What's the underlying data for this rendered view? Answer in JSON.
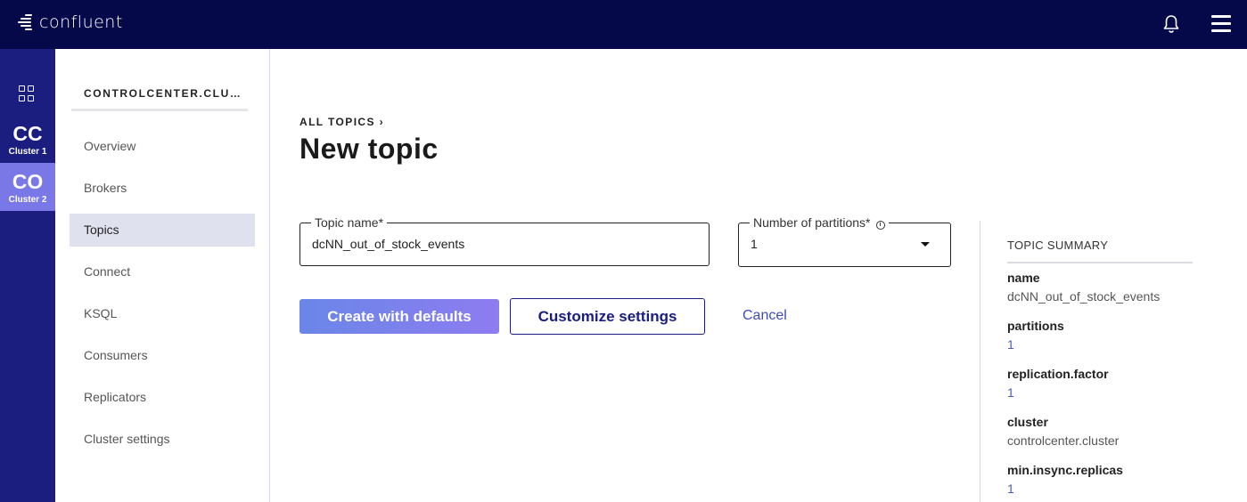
{
  "app": {
    "logo_text": "confluent"
  },
  "topbar": {
    "icons": [
      "bell-icon",
      "hamburger-menu-icon"
    ]
  },
  "clusters": [
    {
      "abbr": "CC",
      "name": "Cluster 1",
      "selected": false
    },
    {
      "abbr": "CO",
      "name": "Cluster 2",
      "selected": true
    }
  ],
  "sidebar": {
    "cluster_title": "CONTROLCENTER.CLUSTER",
    "items": [
      {
        "label": "Overview"
      },
      {
        "label": "Brokers"
      },
      {
        "label": "Topics",
        "active": true
      },
      {
        "label": "Connect"
      },
      {
        "label": "KSQL"
      },
      {
        "label": "Consumers"
      },
      {
        "label": "Replicators"
      },
      {
        "label": "Cluster settings"
      }
    ]
  },
  "main": {
    "breadcrumb": "ALL TOPICS ›",
    "title": "New topic",
    "topic_name_label": "Topic name*",
    "topic_name_value": "dcNN_out_of_stock_events",
    "partitions_label": "Number of partitions*",
    "partitions_value": "1",
    "create_button": "Create with defaults",
    "customize_button": "Customize settings",
    "cancel_link": "Cancel"
  },
  "summary": {
    "title": "TOPIC SUMMARY",
    "rows": [
      {
        "key": "name",
        "value": "dcNN_out_of_stock_events"
      },
      {
        "key": "partitions",
        "value": "1"
      },
      {
        "key": "replication.factor",
        "value": "1"
      },
      {
        "key": "cluster",
        "value": "controlcenter.cluster"
      },
      {
        "key": "min.insync.replicas",
        "value": "1"
      }
    ]
  },
  "colors": {
    "topbar": "#05094a",
    "rail": "#1b1d7f",
    "selected_cluster": "#7a78e6",
    "accent": "#1b1d7f"
  }
}
